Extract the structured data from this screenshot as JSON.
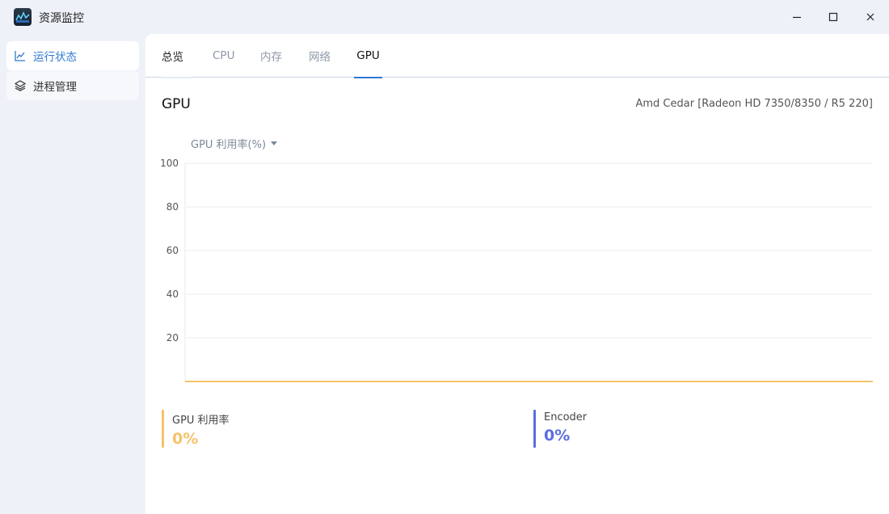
{
  "window": {
    "title": "资源监控",
    "accent": "#2f78d4"
  },
  "sidebar": {
    "items": [
      {
        "label": "运行状态",
        "icon": "line-chart-icon",
        "active": true
      },
      {
        "label": "进程管理",
        "icon": "layers-icon",
        "active": false
      }
    ]
  },
  "tabs": [
    {
      "label": "总览"
    },
    {
      "label": "CPU"
    },
    {
      "label": "内存"
    },
    {
      "label": "网络"
    },
    {
      "label": "GPU",
      "active": true
    }
  ],
  "gpu": {
    "heading": "GPU",
    "model": "Amd Cedar [Radeon HD 7350/8350 / R5 220]",
    "metric_selector": "GPU 利用率(%)"
  },
  "chart_data": {
    "type": "line",
    "ylim": [
      0,
      100
    ],
    "y_ticks": [
      "100",
      "80",
      "60",
      "40",
      "20"
    ],
    "grid": true,
    "series": [
      {
        "name": "GPU 利用率",
        "color": "#f6c26b",
        "values": [
          0,
          0
        ]
      },
      {
        "name": "Encoder",
        "color": "#5b6ee1",
        "values": [
          0,
          0
        ]
      }
    ]
  },
  "stats": [
    {
      "label": "GPU 利用率",
      "value": "0%",
      "color": "#f6c26b"
    },
    {
      "label": "Encoder",
      "value": "0%",
      "color": "#5b6ee1"
    }
  ]
}
